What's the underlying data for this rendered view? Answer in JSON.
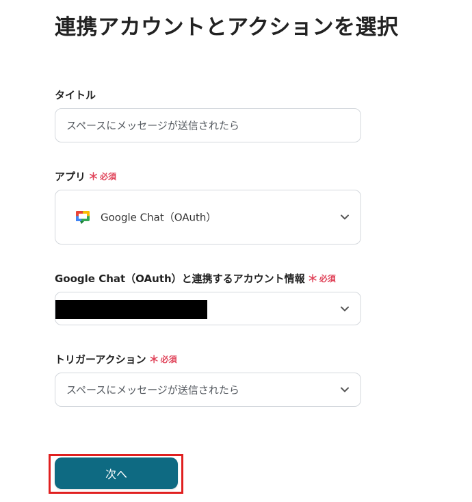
{
  "title": "連携アカウントとアクションを選択",
  "fields": {
    "title_field": {
      "label": "タイトル",
      "value": "スペースにメッセージが送信されたら"
    },
    "app_field": {
      "label": "アプリ",
      "required_star": "＊",
      "required_text": "必須",
      "value": "Google Chat（OAuth）",
      "icon": "google-chat-icon"
    },
    "account_field": {
      "label": "Google Chat（OAuth）と連携するアカウント情報",
      "required_star": "＊",
      "required_text": "必須"
    },
    "trigger_field": {
      "label": "トリガーアクション",
      "required_star": "＊",
      "required_text": "必須",
      "value": "スペースにメッセージが送信されたら"
    }
  },
  "next_button": {
    "label": "次へ"
  },
  "colors": {
    "accent": "#0e6a82",
    "required": "#e0445a",
    "highlight": "#e02020",
    "border": "#d3d7dc"
  }
}
